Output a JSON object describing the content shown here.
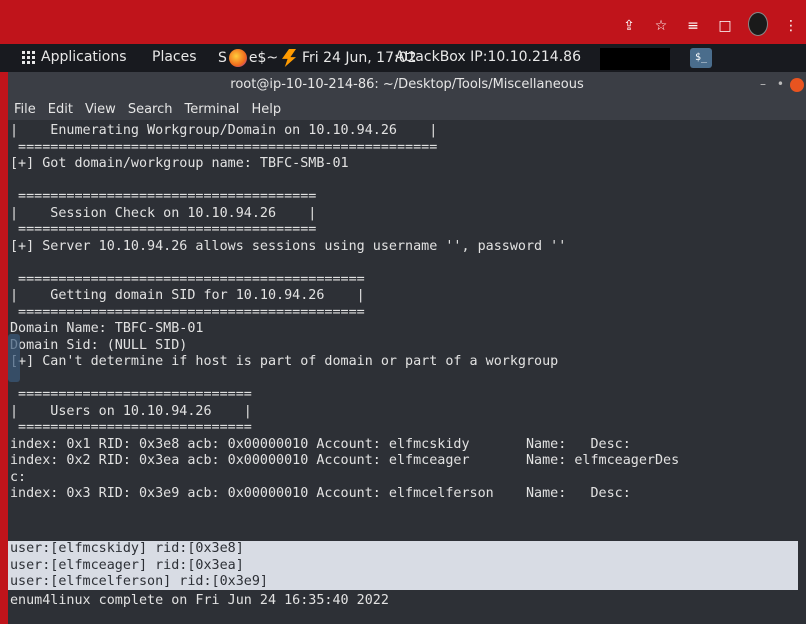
{
  "browser": {
    "icons": [
      "share-icon",
      "star-icon",
      "playlist-icon",
      "window-icon",
      "avatar-icon",
      "kebab-menu-icon"
    ]
  },
  "topbar": {
    "applications": "Applications",
    "places": "Places",
    "shell_prefix": "S",
    "shell_suffix": "e$~",
    "clock": "Fri 24 Jun, 17:02",
    "attackbox": "AttackBox IP:10.10.214.86"
  },
  "window": {
    "title": "root@ip-10-10-214-86: ~/Desktop/Tools/Miscellaneous",
    "controls": [
      "–",
      "•"
    ]
  },
  "menu": [
    "File",
    "Edit",
    "View",
    "Search",
    "Terminal",
    "Help"
  ],
  "terminal": {
    "lines": [
      "|    Enumerating Workgroup/Domain on 10.10.94.26    |",
      " ====================================================",
      "[+] Got domain/workgroup name: TBFC-SMB-01",
      "",
      " =====================================",
      "|    Session Check on 10.10.94.26    |",
      " =====================================",
      "[+] Server 10.10.94.26 allows sessions using username '', password ''",
      "",
      " ===========================================",
      "|    Getting domain SID for 10.10.94.26    |",
      " ===========================================",
      "Domain Name: TBFC-SMB-01",
      "Domain Sid: (NULL SID)",
      "[+] Can't determine if host is part of domain or part of a workgroup",
      "",
      " =============================",
      "|    Users on 10.10.94.26    |",
      " =============================",
      "index: 0x1 RID: 0x3e8 acb: 0x00000010 Account: elfmcskidy       Name:   Desc:",
      "index: 0x2 RID: 0x3ea acb: 0x00000010 Account: elfmceager       Name: elfmceagerDes",
      "c:",
      "index: 0x3 RID: 0x3e9 acb: 0x00000010 Account: elfmcelferson    Name:   Desc:",
      ""
    ],
    "selected_lines": [
      "user:[elfmcskidy] rid:[0x3e8]",
      "user:[elfmceager] rid:[0x3ea]",
      "user:[elfmcelferson] rid:[0x3e9]"
    ],
    "final_line": "enum4linux complete on Fri Jun 24 16:35:40 2022"
  }
}
